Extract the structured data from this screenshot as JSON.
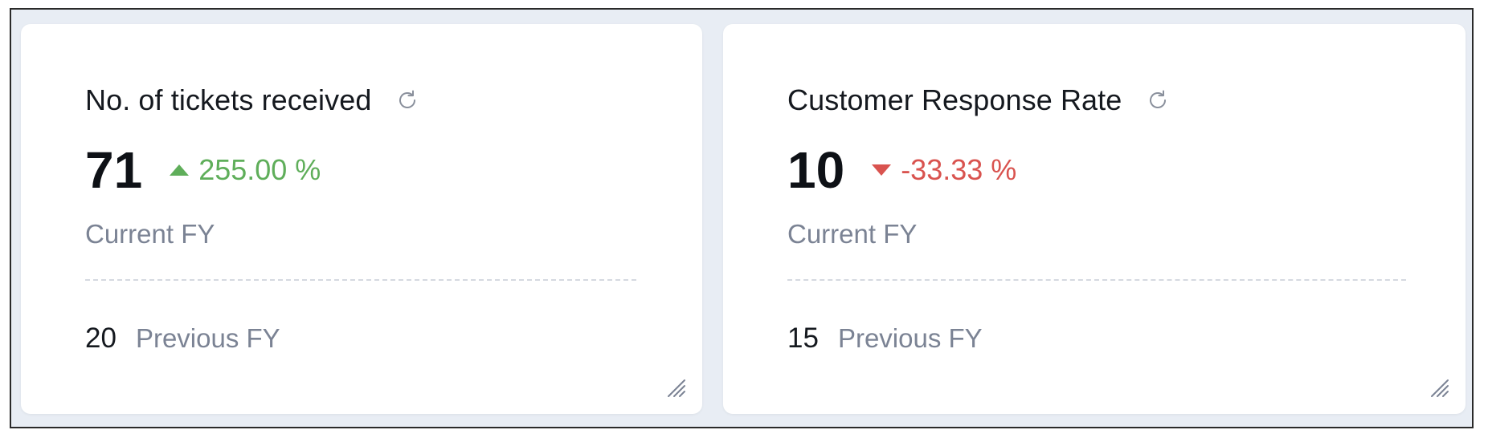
{
  "widgets": [
    {
      "title": "No. of tickets received",
      "value": "71",
      "trend": {
        "direction": "up",
        "percent": "255.00 %",
        "color": "#5fae5a"
      },
      "current_label": "Current FY",
      "previous": {
        "value": "20",
        "label": "Previous FY"
      },
      "icons": {
        "refresh": "refresh-icon",
        "resize": "resize-handle-icon"
      }
    },
    {
      "title": "Customer Response Rate",
      "value": "10",
      "trend": {
        "direction": "down",
        "percent": "-33.33 %",
        "color": "#d9534f"
      },
      "current_label": "Current FY",
      "previous": {
        "value": "15",
        "label": "Previous FY"
      },
      "icons": {
        "refresh": "refresh-icon",
        "resize": "resize-handle-icon"
      }
    }
  ],
  "colors": {
    "background": "#e8edf4",
    "card": "#ffffff",
    "muted_text": "#7b8394"
  }
}
